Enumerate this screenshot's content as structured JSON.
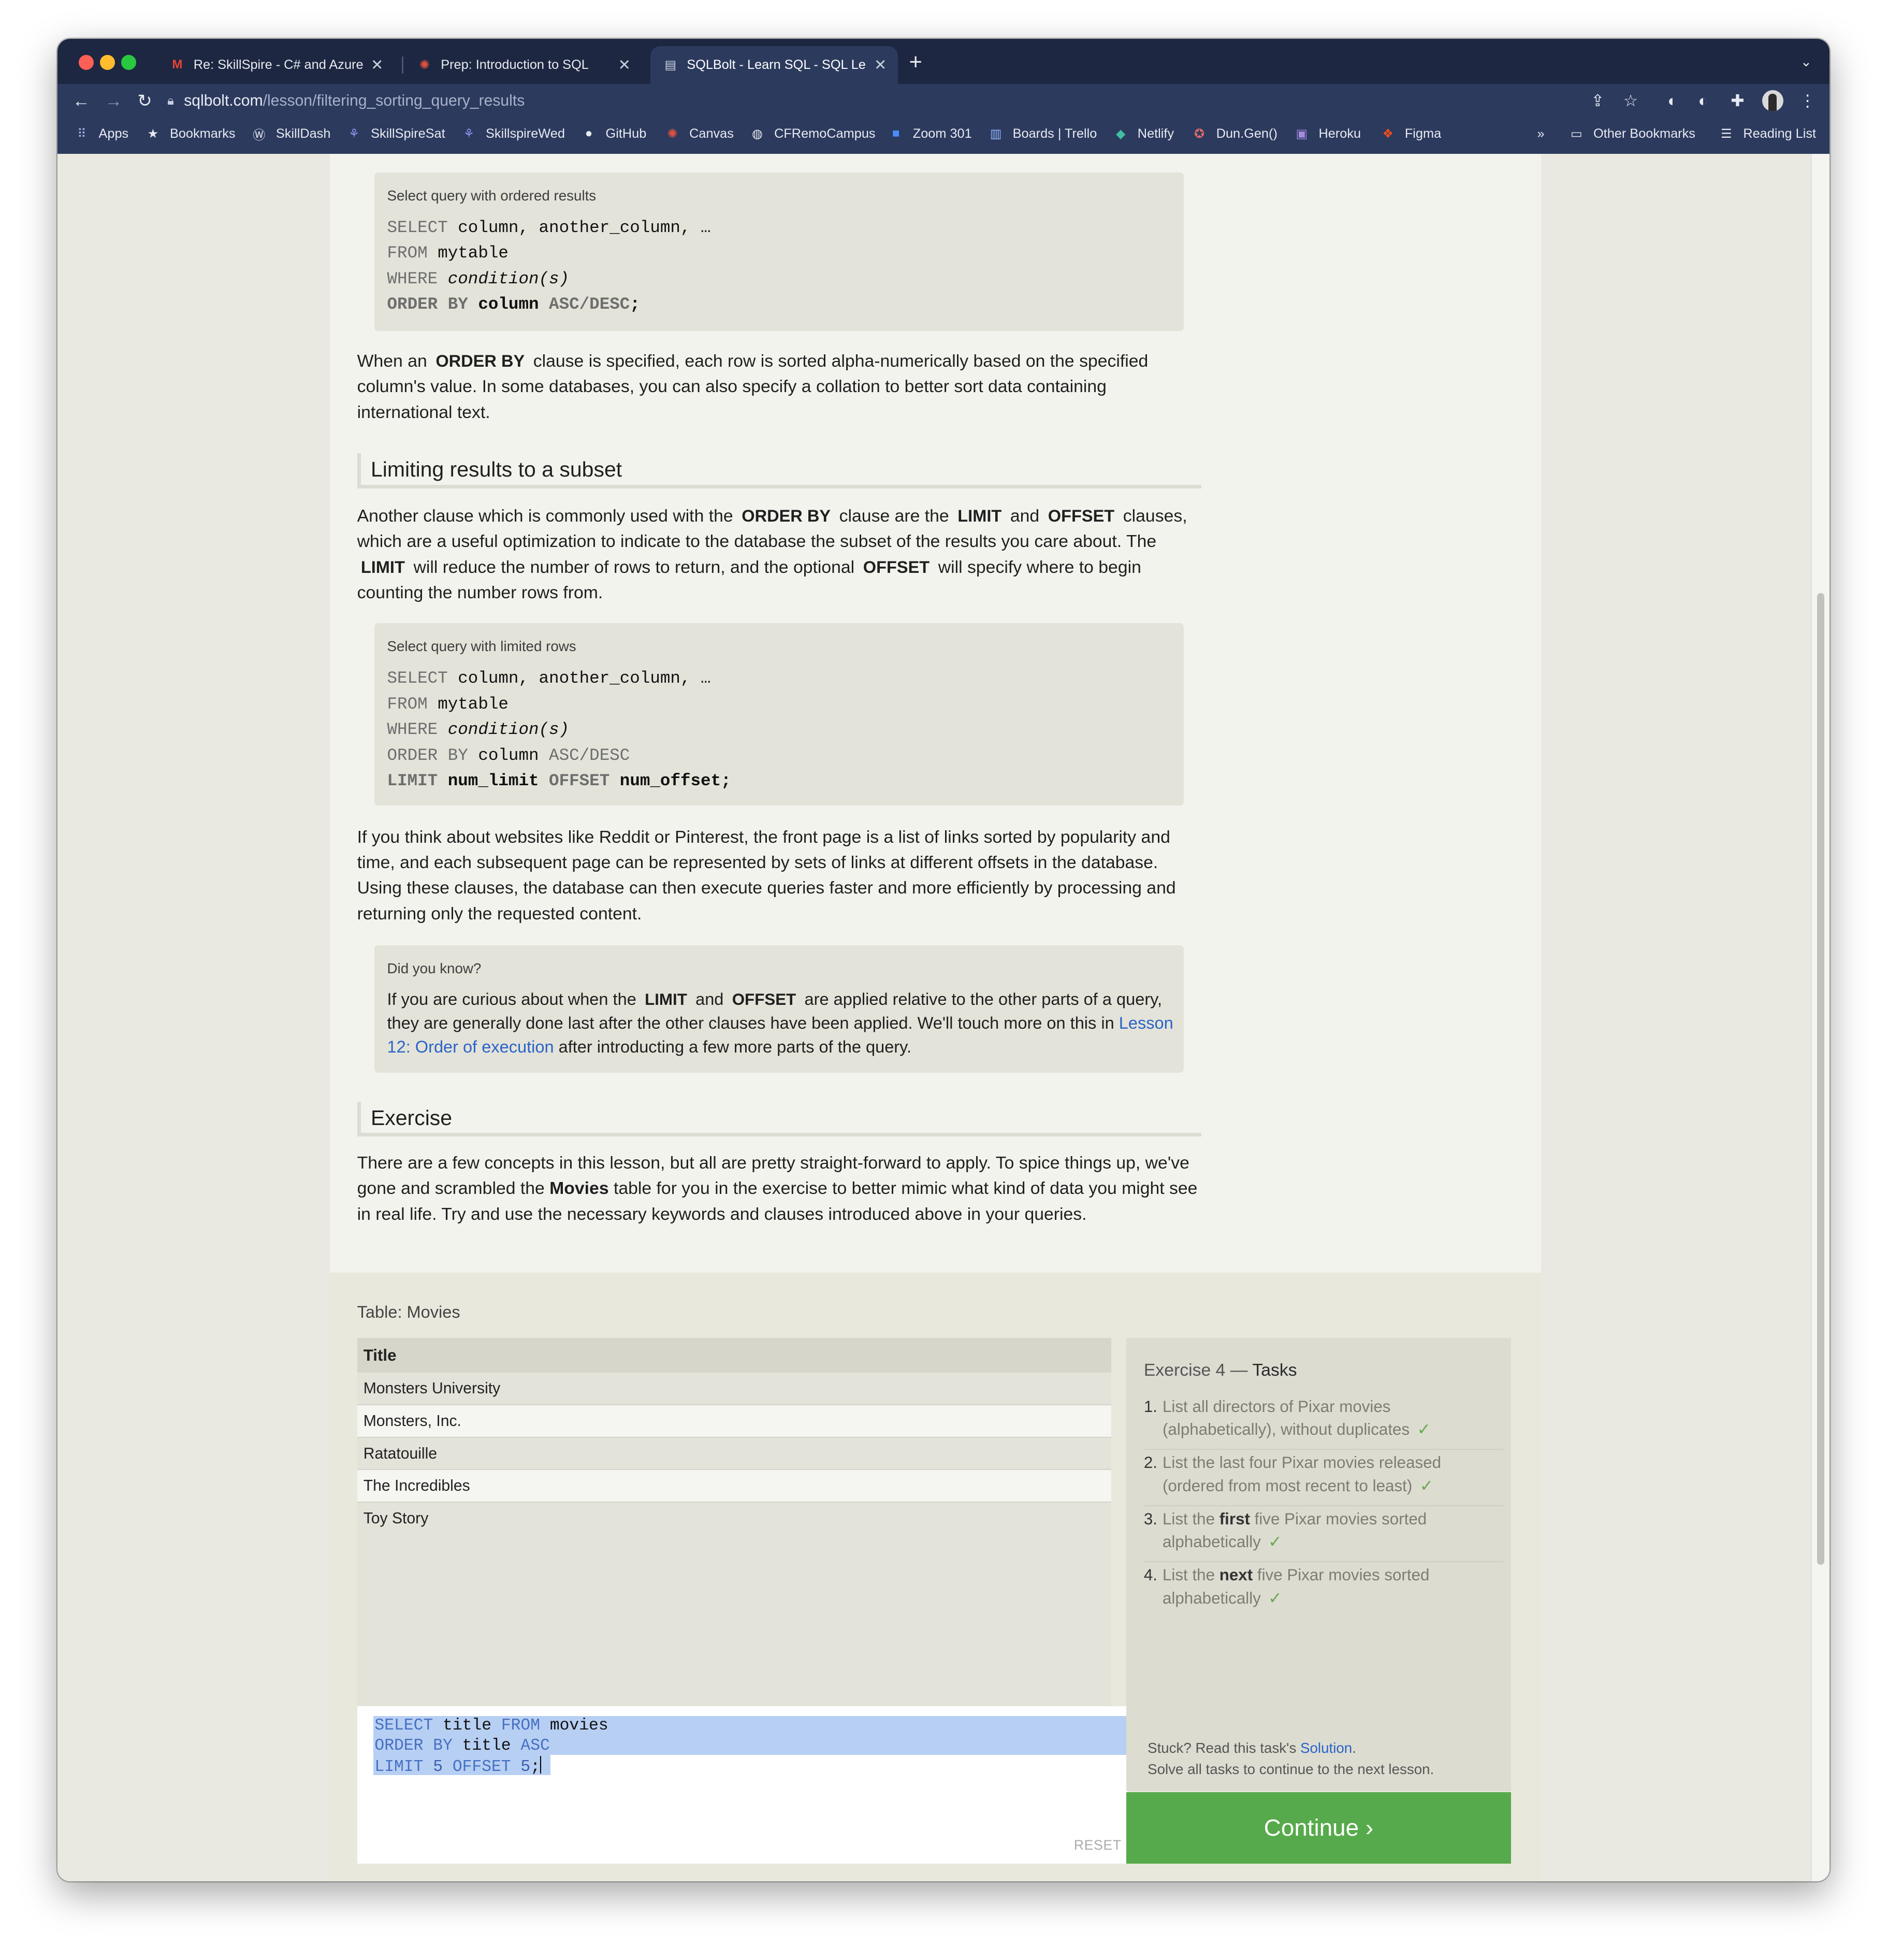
{
  "browser": {
    "tabs": [
      {
        "title": "Re: SkillSpire - C# and Azure -",
        "icon": "gmail-icon"
      },
      {
        "title": "Prep: Introduction to SQL",
        "icon": "canvas-icon"
      },
      {
        "title": "SQLBolt - Learn SQL - SQL Le",
        "icon": "sqlbolt-icon"
      }
    ],
    "url_domain": "sqlbolt.com",
    "url_path": "/lesson/filtering_sorting_query_results",
    "bookmarks": [
      "Apps",
      "Bookmarks",
      "SkillDash",
      "SkillSpireSat",
      "SkillspireWed",
      "GitHub",
      "Canvas",
      "CFRemoCampus",
      "Zoom 301",
      "Boards | Trello",
      "Netlify",
      "Dun.Gen()",
      "Heroku",
      "Figma"
    ],
    "overflow": "»",
    "other_bookmarks": "Other Bookmarks",
    "reading_list": "Reading List"
  },
  "lesson": {
    "box1": {
      "caption": "Select query with ordered results",
      "lines": {
        "l1": {
          "kw": "SELECT",
          "rest": " column, another_column, …"
        },
        "l2": {
          "kw": "FROM",
          "rest": " mytable"
        },
        "l3": {
          "kw": "WHERE",
          "rest": " condition(s)"
        },
        "l4": {
          "kw": "ORDER BY",
          "col": " column",
          "order_kw": " ASC/DESC",
          "end": ";"
        }
      }
    },
    "p1": {
      "a": "When an",
      "tok": "ORDER BY",
      "b": "clause is specified, each row is sorted alpha-numerically based on the specified column's value. In some databases, you can also specify a collation to better sort data containing international text."
    },
    "heading_limit": "Limiting results to a subset",
    "p2": {
      "a": "Another clause which is commonly used with the",
      "t1": "ORDER BY",
      "b": "clause are the",
      "t2": "LIMIT",
      "c": "and",
      "t3": "OFFSET",
      "d": "clauses, which are a useful optimization to indicate to the database the subset of the results you care about. The",
      "t4": "LIMIT",
      "e": "will reduce the number of rows to return, and the optional",
      "t5": "OFFSET",
      "f": "will specify where to begin counting the number rows from."
    },
    "box2": {
      "caption": "Select query with limited rows",
      "lines": {
        "l1": {
          "kw": "SELECT",
          "rest": " column, another_column, …"
        },
        "l2": {
          "kw": "FROM",
          "rest": " mytable"
        },
        "l3": {
          "kw": "WHERE",
          "rest": " condition(s)"
        },
        "l4": {
          "kw": "ORDER BY",
          "rest": " column",
          "order_kw": " ASC/DESC"
        },
        "l5": {
          "kw": "LIMIT",
          "v1": " num_limit",
          "kw2": " OFFSET",
          "v2": " num_offset",
          "end": ";"
        }
      }
    },
    "p3": "If you think about websites like Reddit or Pinterest, the front page is a list of links sorted by popularity and time, and each subsequent page can be represented by sets of links at different offsets in the database. Using these clauses, the database can then execute queries faster and more efficiently by processing and returning only the requested content.",
    "did_you_know": {
      "caption": "Did you know?",
      "a": "If you are curious about when the",
      "t1": "LIMIT",
      "b": "and",
      "t2": "OFFSET",
      "c": "are applied relative to the other parts of a query, they are generally done last after the other clauses have been applied. We'll touch more on this in",
      "link": "Lesson 12: Order of execution",
      "d": "after introducting a few more parts of the query."
    },
    "heading_exercise": "Exercise",
    "p4": {
      "a": "There are a few concepts in this lesson, but all are pretty straight-forward to apply. To spice things up, we've gone and scrambled the",
      "bold": "Movies",
      "b": "table for you in the exercise to better mimic what kind of data you might see in real life. Try and use the necessary keywords and clauses introduced above in your queries."
    }
  },
  "exercise": {
    "table_label": "Table: Movies",
    "column": "Title",
    "rows": [
      "Monsters University",
      "Monsters, Inc.",
      "Ratatouille",
      "The Incredibles",
      "Toy Story"
    ],
    "query": {
      "l1": {
        "k1": "SELECT",
        "v1": " title ",
        "k2": "FROM",
        "v2": " movies"
      },
      "l2": {
        "k1": "ORDER BY",
        "v1": " title ",
        "k2": "ASC"
      },
      "l3": {
        "k1": "LIMIT",
        "n1": " 5 ",
        "k2": "OFFSET",
        "n2": " 5",
        "end": ";"
      }
    },
    "reset": "RESET",
    "tasks_title_a": "Exercise 4",
    "tasks_title_sep": " — ",
    "tasks_title_b": "Tasks",
    "tasks": [
      {
        "num": "1.",
        "text": "List all directors of Pixar movies (alphabetically), without duplicates"
      },
      {
        "num": "2.",
        "text": "List the last four Pixar movies released (ordered from most recent to least)"
      },
      {
        "num": "3.",
        "a": "List the",
        "bold": "first",
        "b": "five Pixar movies sorted alphabetically"
      },
      {
        "num": "4.",
        "a": "List the",
        "bold": "next",
        "b": "five Pixar movies sorted alphabetically"
      }
    ],
    "check": "✓",
    "stuck_a": "Stuck? Read this task's",
    "stuck_link": "Solution",
    "stuck_b": ".",
    "solve_all": "Solve all tasks to continue to the next lesson.",
    "continue": "Continue ›"
  },
  "colors": {
    "continue_green": "#57aa4b",
    "link_blue": "#2a63c8",
    "browser_frame": "#2c3a5e",
    "selection": "#b7cff3"
  }
}
